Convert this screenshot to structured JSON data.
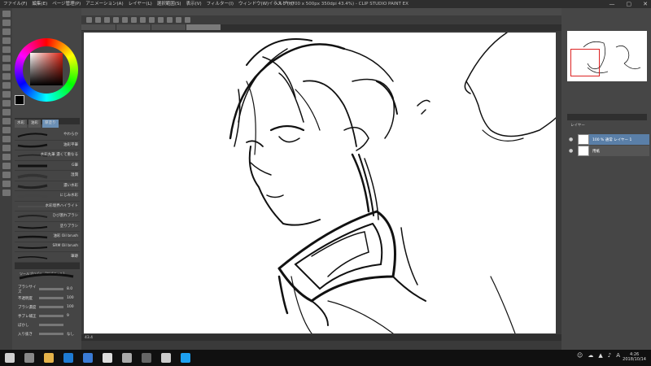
{
  "window": {
    "title": "イラスト* (700 x 500px 350dpi 43.4%) - CLIP STUDIO PAINT EX",
    "controls": [
      "—",
      "▢",
      "✕"
    ]
  },
  "menu": [
    "ファイル(F)",
    "編集(E)",
    "ページ管理(P)",
    "アニメーション(A)",
    "レイヤー(L)",
    "選択範囲(S)",
    "表示(V)",
    "フィルター(I)",
    "ウィンドウ(W)",
    "ヘルプ(H)"
  ],
  "brushes": {
    "tabs": [
      "水彩",
      "油彩",
      "厚塗り"
    ],
    "items": [
      {
        "label": "やわらか"
      },
      {
        "label": "油彩平筆"
      },
      {
        "label": "水彩丸筆 濃くて重なる"
      },
      {
        "label": "G筆"
      },
      {
        "label": "湿潤"
      },
      {
        "label": "濃い水彩"
      },
      {
        "label": "にじみ水彩"
      },
      {
        "label": "水彩境界ハイライト"
      },
      {
        "label": "ひび割れブラシ"
      },
      {
        "label": "塗りブラシ"
      },
      {
        "label": "油彩 Oil brush"
      },
      {
        "label": "SRM Oil brush"
      },
      {
        "label": "筆跡"
      }
    ]
  },
  "tool_property": {
    "header": "ツールプロパティ[サブツール]",
    "rows": [
      {
        "label": "ブラシサイズ",
        "value": "8.0"
      },
      {
        "label": "不透明度",
        "value": "100"
      },
      {
        "label": "ブラシ濃度",
        "value": "100"
      },
      {
        "label": "手ブレ補正",
        "value": "9"
      },
      {
        "label": "ぼかし",
        "value": ""
      },
      {
        "label": "入り抜き",
        "value": "なし"
      }
    ]
  },
  "status": {
    "zoom": "43.4"
  },
  "layers": {
    "header": "レイヤー",
    "items": [
      {
        "name": "100 % 通常 レイヤー 1"
      },
      {
        "name": "用紙"
      }
    ]
  },
  "taskbar": {
    "time": "4:26",
    "date": "2018/10/14",
    "ime": "A"
  },
  "colors": {
    "accent": "#5a7fa8",
    "nav_frame": "#dd2222"
  }
}
